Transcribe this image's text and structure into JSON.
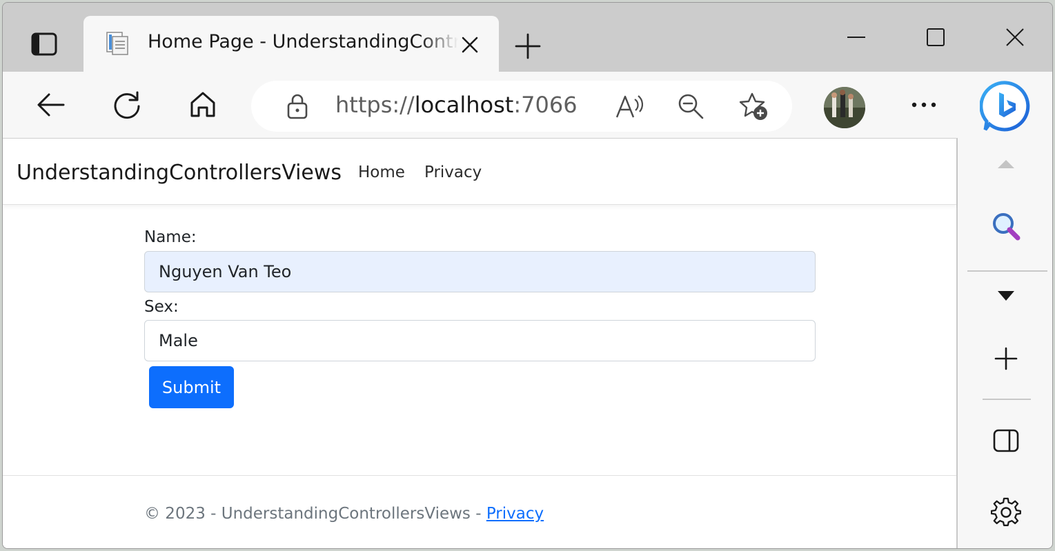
{
  "browser": {
    "tab": {
      "title": "Home Page - UnderstandingControllersViews"
    },
    "address": {
      "scheme": "https://",
      "host": "localhost",
      "port": ":7066"
    },
    "icons": {
      "tab_actions": "tab-actions-icon",
      "favicon": "page-favicon-icon",
      "close": "close-icon",
      "new_tab": "plus-icon",
      "back": "back-arrow-icon",
      "refresh": "refresh-icon",
      "home": "home-icon",
      "lock": "lock-icon",
      "read_aloud": "read-aloud-icon",
      "zoom_out": "zoom-out-icon",
      "favorite_add": "favorite-add-icon",
      "more": "more-icon",
      "copilot": "bing-copilot-icon"
    }
  },
  "site": {
    "brand": "UnderstandingControllersViews",
    "nav": [
      {
        "label": "Home"
      },
      {
        "label": "Privacy"
      }
    ]
  },
  "form": {
    "name_label": "Name:",
    "name_value": "Nguyen Van Teo",
    "sex_label": "Sex:",
    "sex_value": "Male",
    "submit_label": "Submit"
  },
  "footer": {
    "text": "© 2023 - UnderstandingControllersViews - ",
    "link": "Privacy"
  },
  "colors": {
    "primary": "#0d6efd",
    "autofill": "#e8f0fe"
  }
}
